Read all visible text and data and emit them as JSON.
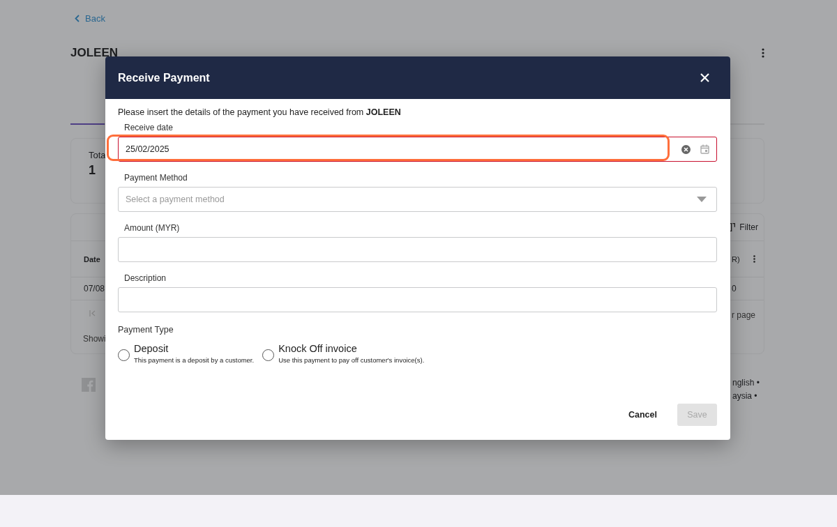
{
  "page": {
    "back_link": "Back",
    "customer_name": "JOLEEN",
    "summary_card": {
      "label": "Tota",
      "value": "1"
    },
    "table": {
      "filter_button": "Filter",
      "columns": [
        "Date",
        "R)"
      ],
      "rows": [
        [
          "07/08",
          "0"
        ]
      ],
      "rows_per_page_label": "r page",
      "showing_text": "Showi"
    },
    "footer_links": [
      "nglish •",
      "aysia •"
    ]
  },
  "dialog": {
    "title": "Receive Payment",
    "intro": "Please insert the details of the payment you have received from **JOLEEN**",
    "fields": [
      {
        "kind": "date",
        "label": "Receive date",
        "value": "25/02/2025",
        "invalid": true
      },
      {
        "kind": "select",
        "label": "Payment Method",
        "placeholder": "Select a payment method"
      },
      {
        "kind": "text",
        "label": "Amount (MYR)"
      },
      {
        "kind": "text",
        "label": "Description"
      }
    ],
    "payment_type": {
      "label": "Payment Type",
      "options": [
        {
          "label": "Deposit",
          "description": "This payment is a deposit by a customer.",
          "selected": false
        },
        {
          "label": "Knock Off invoice",
          "description": "Use this payment to pay off customer's invoice(s).",
          "selected": false
        }
      ]
    },
    "buttons": [
      {
        "label": "Cancel",
        "disabled": false
      },
      {
        "label": "Save",
        "disabled": true
      }
    ]
  }
}
